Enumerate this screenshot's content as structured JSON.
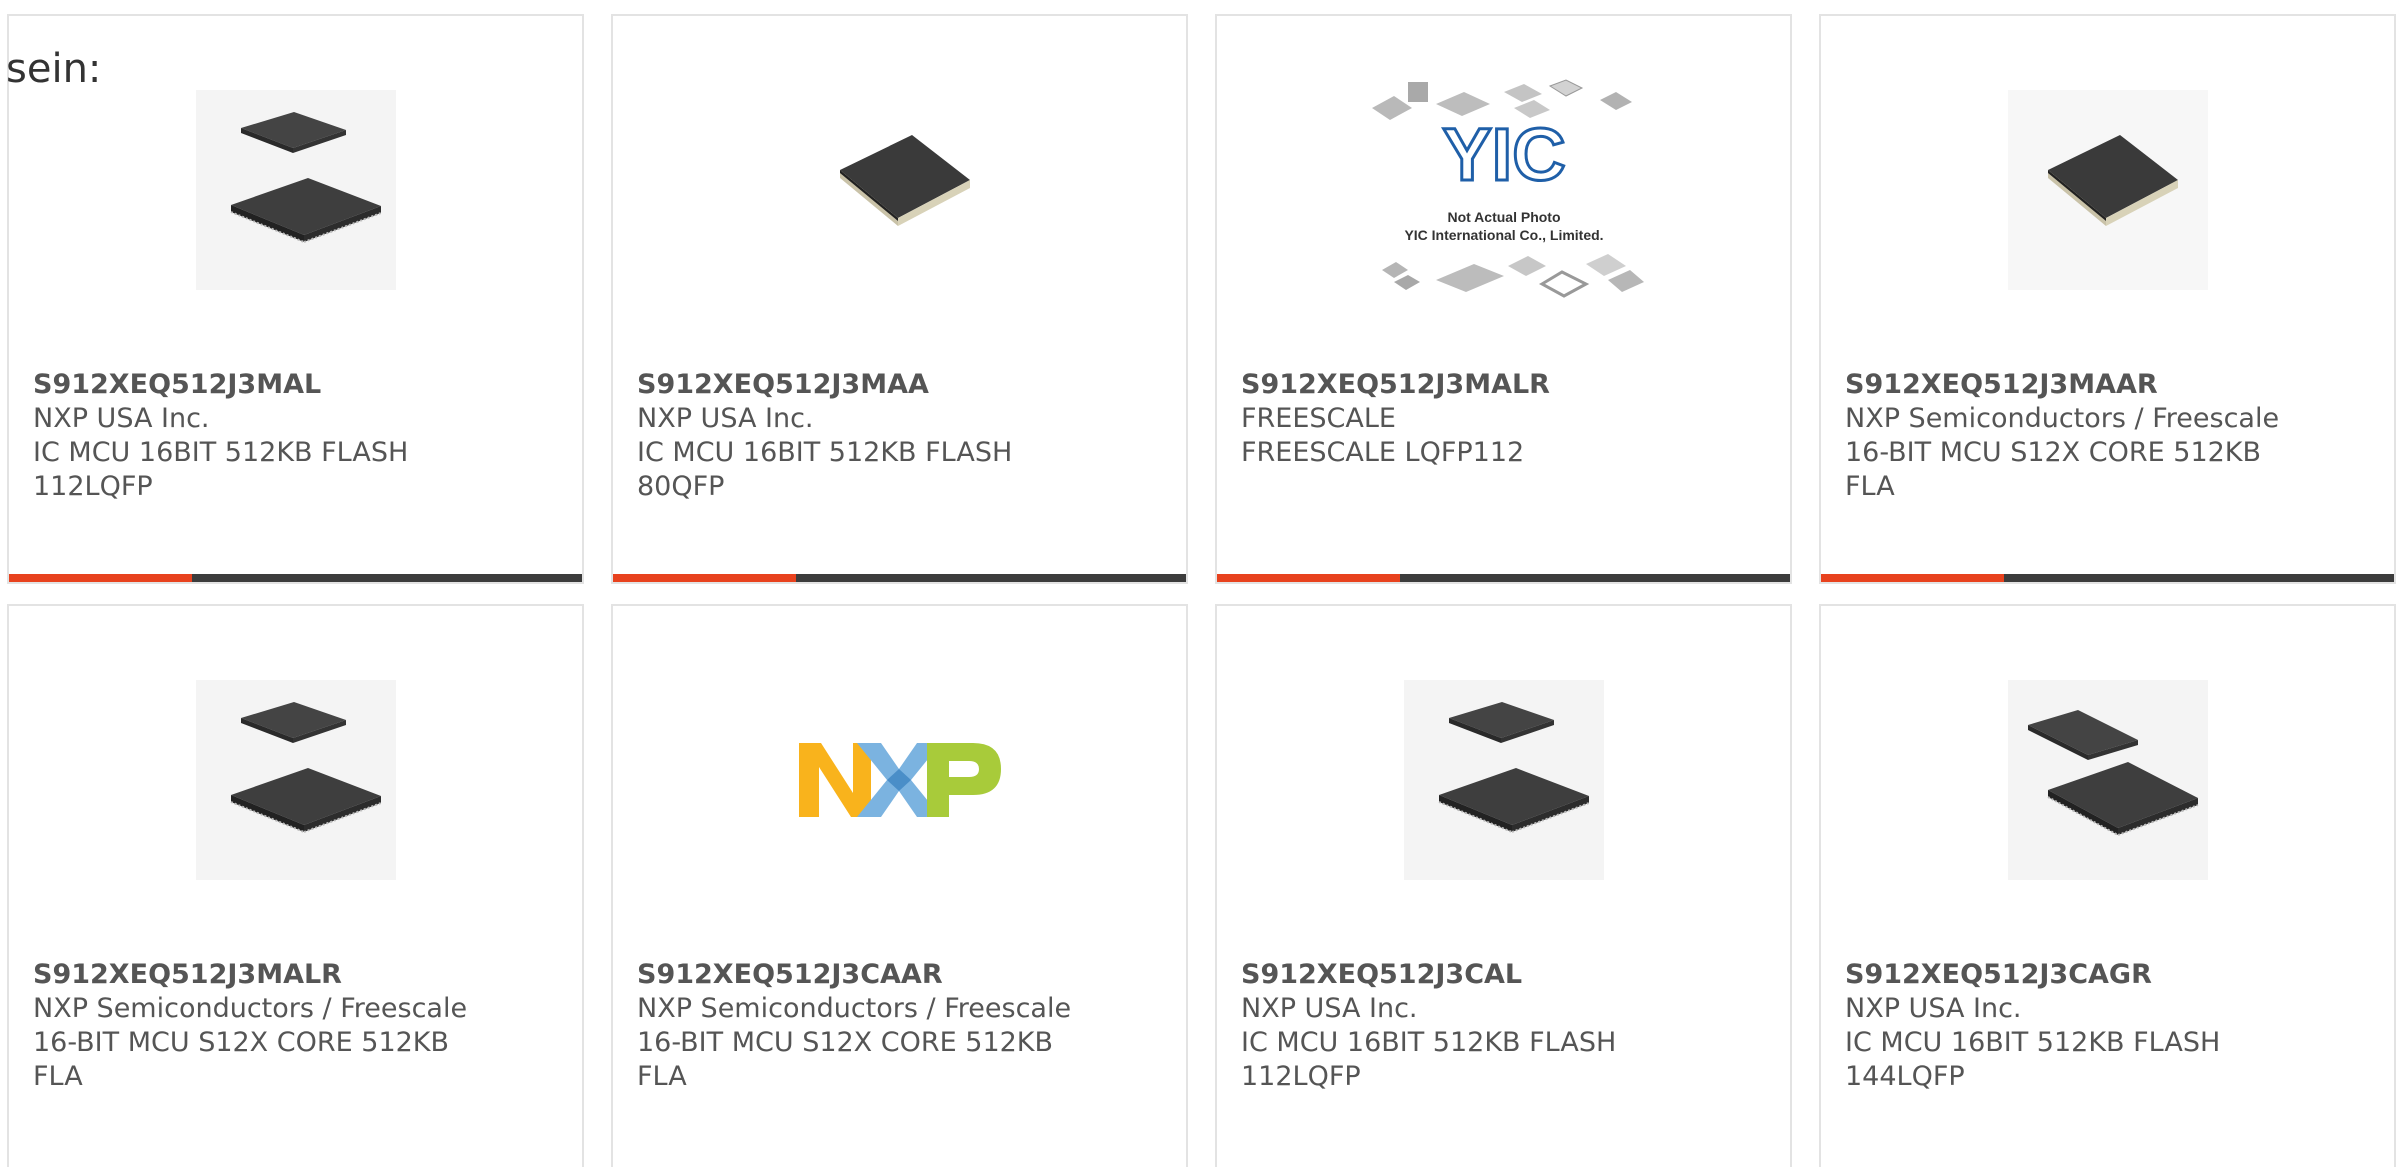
{
  "intro_text": "sein:",
  "accent_color": "#e8421e",
  "products": [
    {
      "part_number": "S912XEQ512J3MAL",
      "manufacturer": "NXP USA Inc.",
      "desc_line1": "IC MCU 16BIT 512KB FLASH",
      "desc_line2": "112LQFP",
      "image": "two-chip-icon"
    },
    {
      "part_number": "S912XEQ512J3MAA",
      "manufacturer": "NXP USA Inc.",
      "desc_line1": "IC MCU 16BIT 512KB FLASH",
      "desc_line2": "80QFP",
      "image": "single-chip-icon"
    },
    {
      "part_number": "S912XEQ512J3MALR",
      "manufacturer": "FREESCALE",
      "desc_line1": "FREESCALE LQFP112",
      "desc_line2": "",
      "image": "yic-placeholder",
      "placeholder_logo": "YIC",
      "placeholder_line1": "Not Actual Photo",
      "placeholder_line2": "YIC International Co., Limited."
    },
    {
      "part_number": "S912XEQ512J3MAAR",
      "manufacturer": "NXP Semiconductors / Freescale",
      "desc_line1": "16-BIT MCU S12X CORE 512KB",
      "desc_line2": "FLA",
      "image": "single-chip-icon"
    },
    {
      "part_number": "S912XEQ512J3MALR",
      "manufacturer": "NXP Semiconductors / Freescale",
      "desc_line1": "16-BIT MCU S12X CORE 512KB",
      "desc_line2": "FLA",
      "image": "two-chip-icon"
    },
    {
      "part_number": "S912XEQ512J3CAAR",
      "manufacturer": "NXP Semiconductors / Freescale",
      "desc_line1": "16-BIT MCU S12X CORE 512KB",
      "desc_line2": "FLA",
      "image": "nxp-logo",
      "logo_text": "NXP"
    },
    {
      "part_number": "S912XEQ512J3CAL",
      "manufacturer": "NXP USA Inc.",
      "desc_line1": "IC MCU 16BIT 512KB FLASH",
      "desc_line2": "112LQFP",
      "image": "two-chip-icon"
    },
    {
      "part_number": "S912XEQ512J3CAGR",
      "manufacturer": "NXP USA Inc.",
      "desc_line1": "IC MCU 16BIT 512KB FLASH",
      "desc_line2": "144LQFP",
      "image": "two-chip-icon"
    }
  ]
}
